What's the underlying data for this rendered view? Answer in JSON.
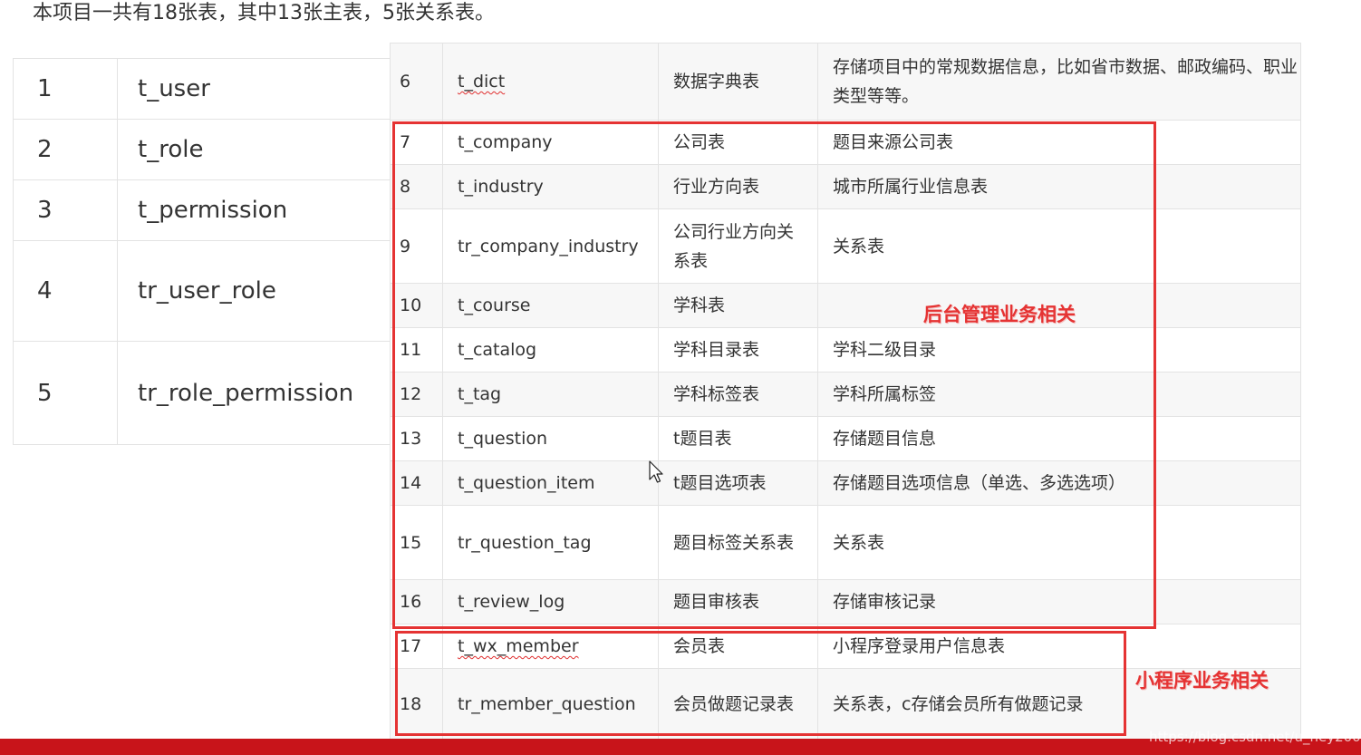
{
  "heading": "本项目一共有18张表，其中13张主表，5张关系表。",
  "left_table": [
    {
      "num": "1",
      "name": "t_user"
    },
    {
      "num": "2",
      "name": "t_role"
    },
    {
      "num": "3",
      "name": "t_permission"
    },
    {
      "num": "4",
      "name": "tr_user_role"
    },
    {
      "num": "5",
      "name": "tr_role_permission"
    }
  ],
  "right_table": [
    {
      "num": "6",
      "name": "t_dict",
      "cn": "数据字典表",
      "desc": "存储项目中的常规数据信息，比如省市数据、邮政编码、职业类型等等。"
    },
    {
      "num": "7",
      "name": "t_company",
      "cn": "公司表",
      "desc": "题目来源公司表"
    },
    {
      "num": "8",
      "name": "t_industry",
      "cn": "行业方向表",
      "desc": "城市所属行业信息表"
    },
    {
      "num": "9",
      "name": "tr_company_industry",
      "cn": "公司行业方向关系表",
      "desc": "关系表"
    },
    {
      "num": "10",
      "name": "t_course",
      "cn": "学科表",
      "desc": ""
    },
    {
      "num": "11",
      "name": "t_catalog",
      "cn": "学科目录表",
      "desc": "学科二级目录"
    },
    {
      "num": "12",
      "name": "t_tag",
      "cn": "学科标签表",
      "desc": "学科所属标签"
    },
    {
      "num": "13",
      "name": "t_question",
      "cn": "t题目表",
      "desc": "存储题目信息"
    },
    {
      "num": "14",
      "name": "t_question_item",
      "cn": "t题目选项表",
      "desc": "存储题目选项信息（单选、多选选项）"
    },
    {
      "num": "15",
      "name": "tr_question_tag",
      "cn": "题目标签关系表",
      "desc": "关系表"
    },
    {
      "num": "16",
      "name": "t_review_log",
      "cn": "题目审核表",
      "desc": "存储审核记录"
    },
    {
      "num": "17",
      "name": "t_wx_member",
      "cn": "会员表",
      "desc": "小程序登录用户信息表"
    },
    {
      "num": "18",
      "name": "tr_member_question",
      "cn": "会员做题记录表",
      "desc": "关系表，c存储会员所有做题记录"
    }
  ],
  "annotations": {
    "admin": "后台管理业务相关",
    "mini": "小程序业务相关"
  },
  "watermark": "https://blog.csdn.net/u_ney2000",
  "colors": {
    "annotation_red": "#e53333",
    "table_border_blue": "#5aa9e6",
    "bottom_bar": "#c8141a"
  }
}
